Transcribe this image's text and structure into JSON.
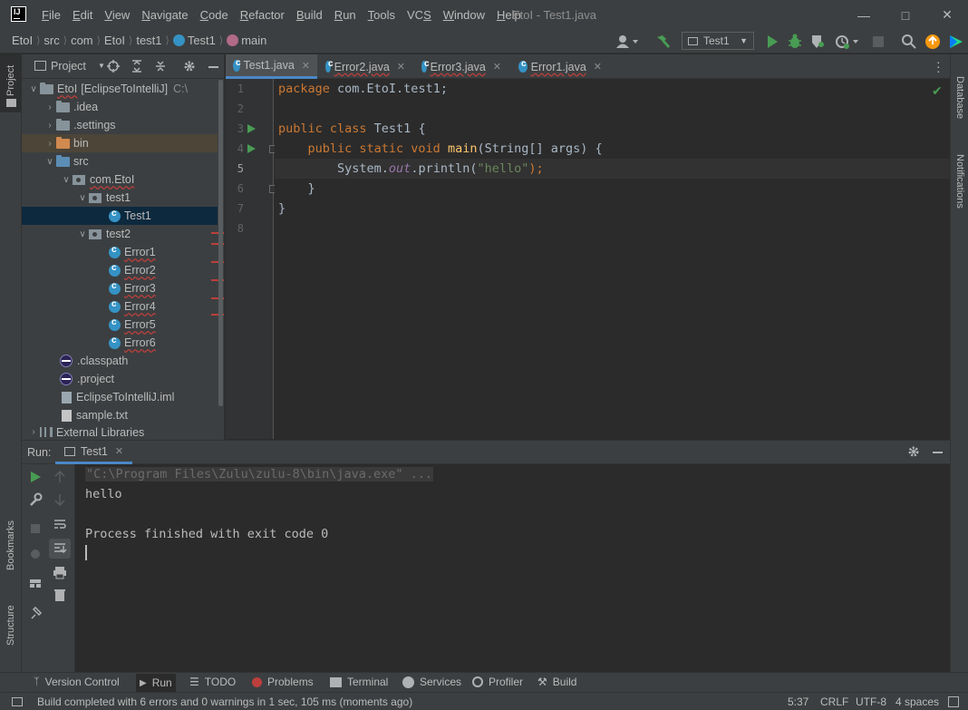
{
  "menu": [
    "File",
    "Edit",
    "View",
    "Navigate",
    "Code",
    "Refactor",
    "Build",
    "Run",
    "Tools",
    "VCS",
    "Window",
    "Help"
  ],
  "menu_mnemonics": [
    "F",
    "E",
    "V",
    "N",
    "C",
    "R",
    "B",
    "R",
    "T",
    "S",
    "W",
    "H"
  ],
  "window_title": "EtoI - Test1.java",
  "breadcrumb": [
    "EtoI",
    "src",
    "com",
    "EtoI",
    "test1",
    "Test1",
    "main"
  ],
  "run_config": "Test1",
  "project_panel": {
    "title": "Project",
    "tree": [
      {
        "label": "EtoI",
        "extra": "[EclipseToIntelliJ]",
        "path": "C:\\",
        "depth": 0,
        "icon": "folder"
      },
      {
        "label": ".idea",
        "depth": 1,
        "icon": "folder"
      },
      {
        "label": ".settings",
        "depth": 1,
        "icon": "folder"
      },
      {
        "label": "bin",
        "depth": 1,
        "icon": "folder-orange"
      },
      {
        "label": "src",
        "depth": 1,
        "icon": "folder-blue"
      },
      {
        "label": "com.EtoI",
        "depth": 2,
        "icon": "package"
      },
      {
        "label": "test1",
        "depth": 3,
        "icon": "package"
      },
      {
        "label": "Test1",
        "depth": 4,
        "icon": "class"
      },
      {
        "label": "test2",
        "depth": 3,
        "icon": "package"
      },
      {
        "label": "Error1",
        "depth": 4,
        "icon": "class"
      },
      {
        "label": "Error2",
        "depth": 4,
        "icon": "class"
      },
      {
        "label": "Error3",
        "depth": 4,
        "icon": "class"
      },
      {
        "label": "Error4",
        "depth": 4,
        "icon": "class"
      },
      {
        "label": "Error5",
        "depth": 4,
        "icon": "class"
      },
      {
        "label": "Error6",
        "depth": 4,
        "icon": "class"
      },
      {
        "label": ".classpath",
        "depth": 1,
        "icon": "eclipse"
      },
      {
        "label": ".project",
        "depth": 1,
        "icon": "eclipse"
      },
      {
        "label": "EclipseToIntelliJ.iml",
        "depth": 1,
        "icon": "iml"
      },
      {
        "label": "sample.txt",
        "depth": 1,
        "icon": "text"
      },
      {
        "label": "External Libraries",
        "depth": 0,
        "icon": "libraries"
      }
    ]
  },
  "editor_tabs": [
    "Test1.java",
    "Error2.java",
    "Error3.java",
    "Error1.java"
  ],
  "line_numbers": [
    "1",
    "2",
    "3",
    "4",
    "5",
    "6",
    "7",
    "8"
  ],
  "code": {
    "line1_kw": "package",
    "line1_rest": " com.EtoI.test1;",
    "line3_kw": "public class",
    "line3_rest": " Test1 {",
    "line4_indent": "    ",
    "line4_kw": "public static void",
    "line4_fn": " main",
    "line4_rest": "(String[] args) {",
    "line5_pre": "        System.",
    "line5_field": "out",
    "line5_mid": ".println(",
    "line5_str": "\"hello\"",
    "line5_post": ");",
    "line6": "    }",
    "line7": "}"
  },
  "run_panel": {
    "label": "Run:",
    "tab": "Test1",
    "console": {
      "cmd": "\"C:\\Program Files\\Zulu\\zulu-8\\bin\\java.exe\" ...",
      "output": "hello",
      "exit": "Process finished with exit code 0"
    }
  },
  "side_tabs": {
    "left_top": "Project",
    "left_bookmarks": "Bookmarks",
    "left_structure": "Structure",
    "right_database": "Database",
    "right_notifications": "Notifications"
  },
  "bottom_tools": [
    "Version Control",
    "Run",
    "TODO",
    "Problems",
    "Terminal",
    "Services",
    "Profiler",
    "Build"
  ],
  "status": {
    "message": "Build completed with 6 errors and 0 warnings in 1 sec, 105 ms (moments ago)",
    "position": "5:37",
    "line_sep": "CRLF",
    "encoding": "UTF-8",
    "indent": "4 spaces"
  },
  "colors": {
    "accent": "#4a88c7",
    "run_green": "#499c54",
    "error_red": "#bc3f3c",
    "keyword": "#cc7832",
    "string": "#6a8759"
  }
}
